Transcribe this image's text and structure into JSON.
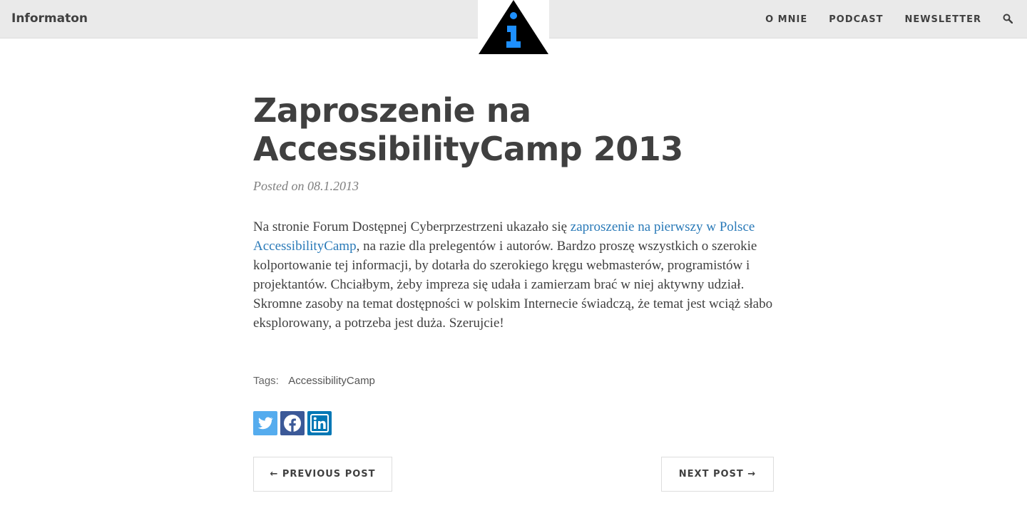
{
  "nav": {
    "brand": "Informaton",
    "links": [
      "O MNIE",
      "PODCAST",
      "NEWSLETTER"
    ],
    "search_icon": "search-icon"
  },
  "logo": {
    "icon": "information-triangle-logo",
    "colors": {
      "triangle": "#000000",
      "letter": "#1e90ff"
    }
  },
  "post": {
    "title": "Zaproszenie na AccessibilityCamp 2013",
    "meta": "Posted on 08.1.2013",
    "body_before_link": "Na stronie Forum Dostępnej Cyberprzestrzeni ukazało się ",
    "link_text": "zaproszenie na pierwszy w Polsce AccessibilityCamp",
    "body_after_link": ", na razie dla prelegentów i autorów. Bardzo proszę wszystkich o szerokie kolportowanie tej informacji, by dotarła do szerokiego kręgu webmasterów, programistów i projektantów. Chciałbym, żeby impreza się udała i zamierzam brać w niej aktywny udział. Skromne zasoby na temat dostępności w polskim Internecie świadczą, że temat jest wciąż słabo eksplorowany, a potrzeba jest duża. Szerujcie!"
  },
  "tags": {
    "label": "Tags:",
    "items": [
      "AccessibilityCamp"
    ]
  },
  "share": [
    {
      "icon": "twitter-icon",
      "color": "#55acee"
    },
    {
      "icon": "facebook-icon",
      "color": "#3b5998"
    },
    {
      "icon": "linkedin-icon",
      "color": "#0077b5"
    }
  ],
  "pager": {
    "previous": "← PREVIOUS POST",
    "next": "NEXT POST →"
  },
  "colors": {
    "link": "#2a7ab8",
    "navbar_bg": "#eaeaea",
    "text": "#404040"
  }
}
